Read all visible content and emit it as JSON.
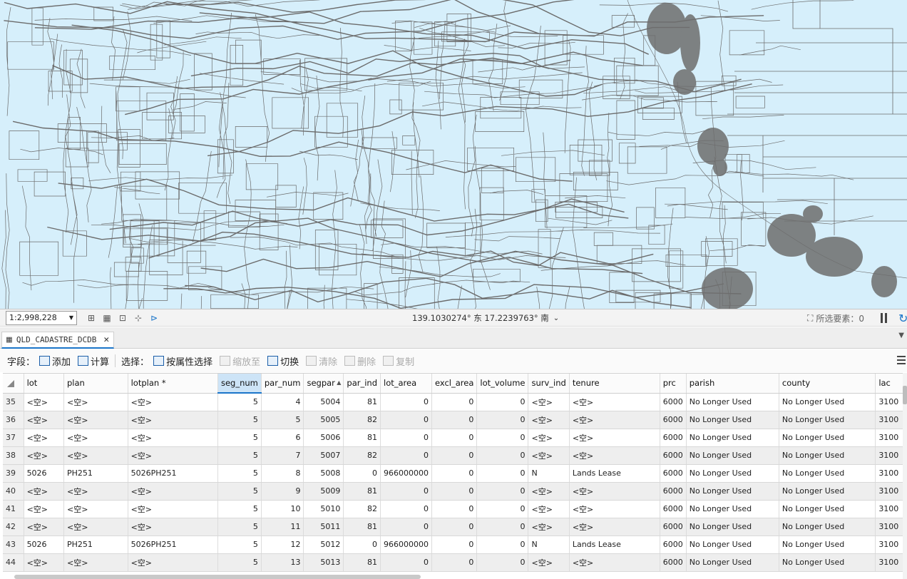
{
  "map": {
    "scale": "1:2,998,228",
    "coordinates": "139.1030274° 东 17.2239763° 南",
    "selected_features": "所选要素：0",
    "colors": {
      "background": "#d6effb",
      "boundary": "#6b6b6b"
    }
  },
  "tab": {
    "title": "QLD_CADASTRE_DCDB"
  },
  "toolbar": {
    "field_label": "字段：",
    "add": "添加",
    "calculate": "计算",
    "select_label": "选择：",
    "select_by_attr": "按属性选择",
    "zoom_to": "缩放至",
    "switch": "切换",
    "clear": "清除",
    "delete": "删除",
    "copy": "复制"
  },
  "table": {
    "columns": [
      "lot",
      "plan",
      "lotplan *",
      "seg_num",
      "par_num",
      "segpar",
      "par_ind",
      "lot_area",
      "excl_area",
      "lot_volume",
      "surv_ind",
      "tenure",
      "prc",
      "parish",
      "county",
      "lac"
    ],
    "rows": [
      {
        "n": "35",
        "lot": "<空>",
        "plan": "<空>",
        "lotplan": "<空>",
        "seg_num": "5",
        "par_num": "4",
        "segpar": "5004",
        "par_ind": "81",
        "lot_area": "0",
        "excl_area": "0",
        "lot_volume": "0",
        "surv_ind": "<空>",
        "tenure": "<空>",
        "prc": "6000",
        "parish": "No Longer Used",
        "county": "No Longer Used",
        "lac": "3100"
      },
      {
        "n": "36",
        "lot": "<空>",
        "plan": "<空>",
        "lotplan": "<空>",
        "seg_num": "5",
        "par_num": "5",
        "segpar": "5005",
        "par_ind": "82",
        "lot_area": "0",
        "excl_area": "0",
        "lot_volume": "0",
        "surv_ind": "<空>",
        "tenure": "<空>",
        "prc": "6000",
        "parish": "No Longer Used",
        "county": "No Longer Used",
        "lac": "3100"
      },
      {
        "n": "37",
        "lot": "<空>",
        "plan": "<空>",
        "lotplan": "<空>",
        "seg_num": "5",
        "par_num": "6",
        "segpar": "5006",
        "par_ind": "81",
        "lot_area": "0",
        "excl_area": "0",
        "lot_volume": "0",
        "surv_ind": "<空>",
        "tenure": "<空>",
        "prc": "6000",
        "parish": "No Longer Used",
        "county": "No Longer Used",
        "lac": "3100"
      },
      {
        "n": "38",
        "lot": "<空>",
        "plan": "<空>",
        "lotplan": "<空>",
        "seg_num": "5",
        "par_num": "7",
        "segpar": "5007",
        "par_ind": "82",
        "lot_area": "0",
        "excl_area": "0",
        "lot_volume": "0",
        "surv_ind": "<空>",
        "tenure": "<空>",
        "prc": "6000",
        "parish": "No Longer Used",
        "county": "No Longer Used",
        "lac": "3100"
      },
      {
        "n": "39",
        "lot": "5026",
        "plan": "PH251",
        "lotplan": "5026PH251",
        "seg_num": "5",
        "par_num": "8",
        "segpar": "5008",
        "par_ind": "0",
        "lot_area": "966000000",
        "excl_area": "0",
        "lot_volume": "0",
        "surv_ind": "N",
        "tenure": "Lands Lease",
        "prc": "6000",
        "parish": "No Longer Used",
        "county": "No Longer Used",
        "lac": "3100"
      },
      {
        "n": "40",
        "lot": "<空>",
        "plan": "<空>",
        "lotplan": "<空>",
        "seg_num": "5",
        "par_num": "9",
        "segpar": "5009",
        "par_ind": "81",
        "lot_area": "0",
        "excl_area": "0",
        "lot_volume": "0",
        "surv_ind": "<空>",
        "tenure": "<空>",
        "prc": "6000",
        "parish": "No Longer Used",
        "county": "No Longer Used",
        "lac": "3100"
      },
      {
        "n": "41",
        "lot": "<空>",
        "plan": "<空>",
        "lotplan": "<空>",
        "seg_num": "5",
        "par_num": "10",
        "segpar": "5010",
        "par_ind": "82",
        "lot_area": "0",
        "excl_area": "0",
        "lot_volume": "0",
        "surv_ind": "<空>",
        "tenure": "<空>",
        "prc": "6000",
        "parish": "No Longer Used",
        "county": "No Longer Used",
        "lac": "3100"
      },
      {
        "n": "42",
        "lot": "<空>",
        "plan": "<空>",
        "lotplan": "<空>",
        "seg_num": "5",
        "par_num": "11",
        "segpar": "5011",
        "par_ind": "81",
        "lot_area": "0",
        "excl_area": "0",
        "lot_volume": "0",
        "surv_ind": "<空>",
        "tenure": "<空>",
        "prc": "6000",
        "parish": "No Longer Used",
        "county": "No Longer Used",
        "lac": "3100"
      },
      {
        "n": "43",
        "lot": "5026",
        "plan": "PH251",
        "lotplan": "5026PH251",
        "seg_num": "5",
        "par_num": "12",
        "segpar": "5012",
        "par_ind": "0",
        "lot_area": "966000000",
        "excl_area": "0",
        "lot_volume": "0",
        "surv_ind": "N",
        "tenure": "Lands Lease",
        "prc": "6000",
        "parish": "No Longer Used",
        "county": "No Longer Used",
        "lac": "3100"
      },
      {
        "n": "44",
        "lot": "<空>",
        "plan": "<空>",
        "lotplan": "<空>",
        "seg_num": "5",
        "par_num": "13",
        "segpar": "5013",
        "par_ind": "81",
        "lot_area": "0",
        "excl_area": "0",
        "lot_volume": "0",
        "surv_ind": "<空>",
        "tenure": "<空>",
        "prc": "6000",
        "parish": "No Longer Used",
        "county": "No Longer Used",
        "lac": "3100"
      }
    ]
  }
}
